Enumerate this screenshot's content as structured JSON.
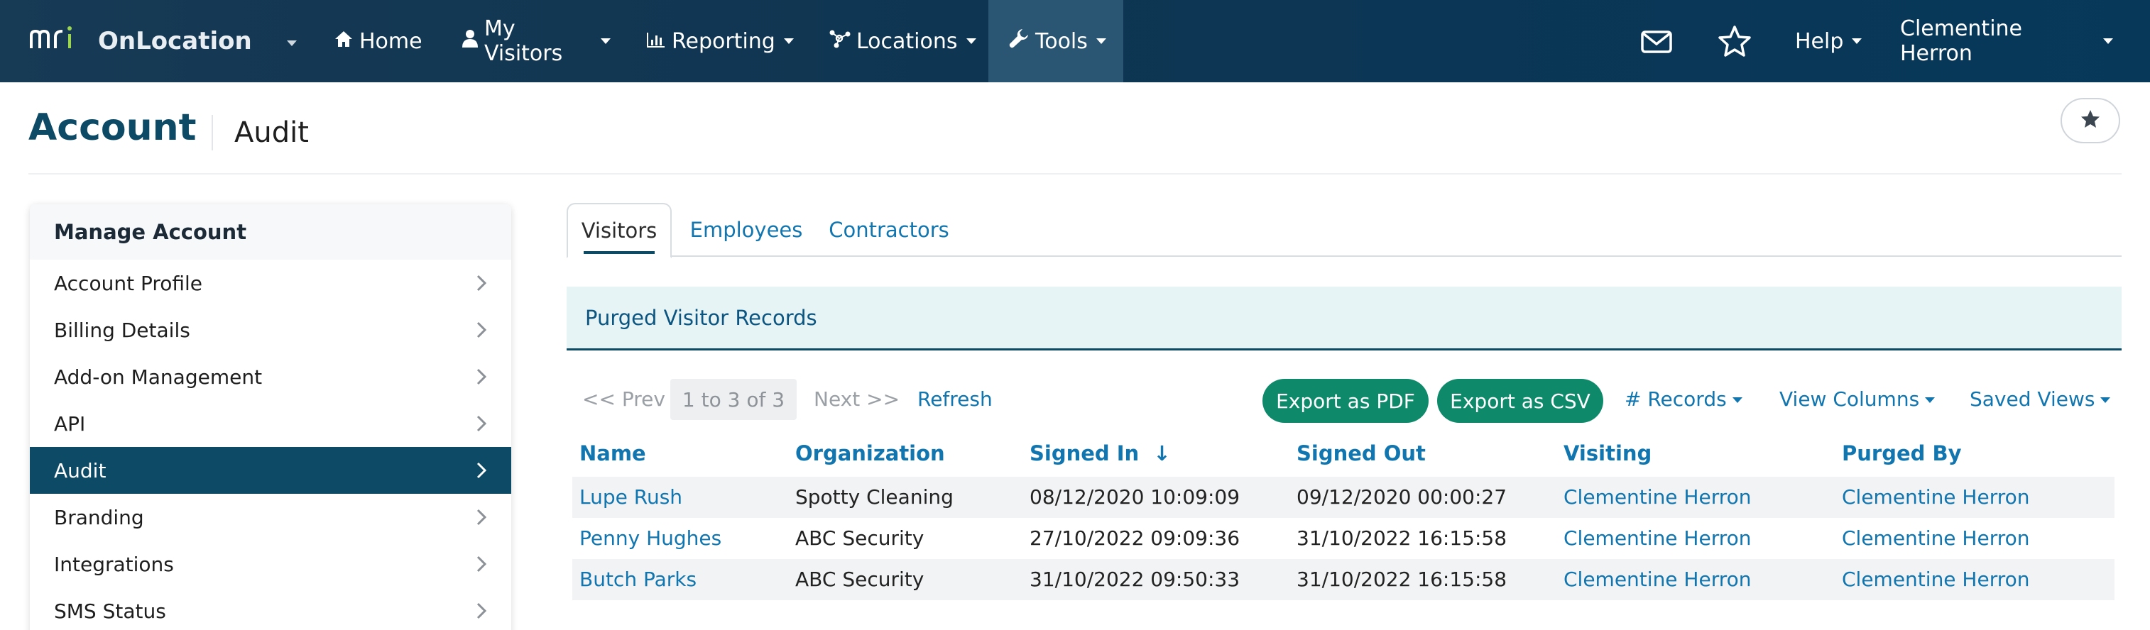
{
  "brand": {
    "logo_text": "mri",
    "app_name": "OnLocation"
  },
  "nav": {
    "items": [
      {
        "label": "Home",
        "icon": "home-icon"
      },
      {
        "label": "My Visitors",
        "icon": "user-icon"
      },
      {
        "label": "Reporting",
        "icon": "bar-chart-icon"
      },
      {
        "label": "Locations",
        "icon": "network-icon"
      },
      {
        "label": "Tools",
        "icon": "wrench-icon"
      }
    ],
    "help_label": "Help",
    "user_name": "Clementine Herron"
  },
  "header": {
    "title": "Account",
    "subtitle": "Audit"
  },
  "sidebar": {
    "heading": "Manage Account",
    "items": [
      {
        "label": "Account Profile"
      },
      {
        "label": "Billing Details"
      },
      {
        "label": "Add-on Management"
      },
      {
        "label": "API"
      },
      {
        "label": "Audit"
      },
      {
        "label": "Branding"
      },
      {
        "label": "Integrations"
      },
      {
        "label": "SMS Status"
      }
    ],
    "active": "Audit"
  },
  "tabs": [
    {
      "label": "Visitors"
    },
    {
      "label": "Employees"
    },
    {
      "label": "Contractors"
    }
  ],
  "panel": {
    "title": "Purged Visitor Records"
  },
  "toolbar": {
    "prev_label": "<< Prev",
    "count_label": "1 to 3 of 3",
    "next_label": "Next >>",
    "refresh_label": "Refresh",
    "export_pdf_label": "Export as PDF",
    "export_csv_label": "Export as CSV",
    "records_label": "# Records",
    "view_columns_label": "View Columns",
    "saved_views_label": "Saved Views"
  },
  "table": {
    "columns": [
      "Name",
      "Organization",
      "Signed In",
      "Signed Out",
      "Visiting",
      "Purged By"
    ],
    "sort_indicator": "↓",
    "rows": [
      [
        "Lupe Rush",
        "Spotty Cleaning",
        "08/12/2020 10:09:09",
        "09/12/2020 00:00:27",
        "Clementine Herron",
        "Clementine Herron"
      ],
      [
        "Penny Hughes",
        "ABC Security",
        "27/10/2022 09:09:36",
        "31/10/2022 16:15:58",
        "Clementine Herron",
        "Clementine Herron"
      ],
      [
        "Butch Parks",
        "ABC Security",
        "31/10/2022 09:50:33",
        "31/10/2022 16:15:58",
        "Clementine Herron",
        "Clementine Herron"
      ]
    ]
  },
  "colors": {
    "navy": "#0c4a66",
    "link": "#1176b0",
    "green": "#0e8a6b",
    "banner": "#e7f4f5"
  }
}
